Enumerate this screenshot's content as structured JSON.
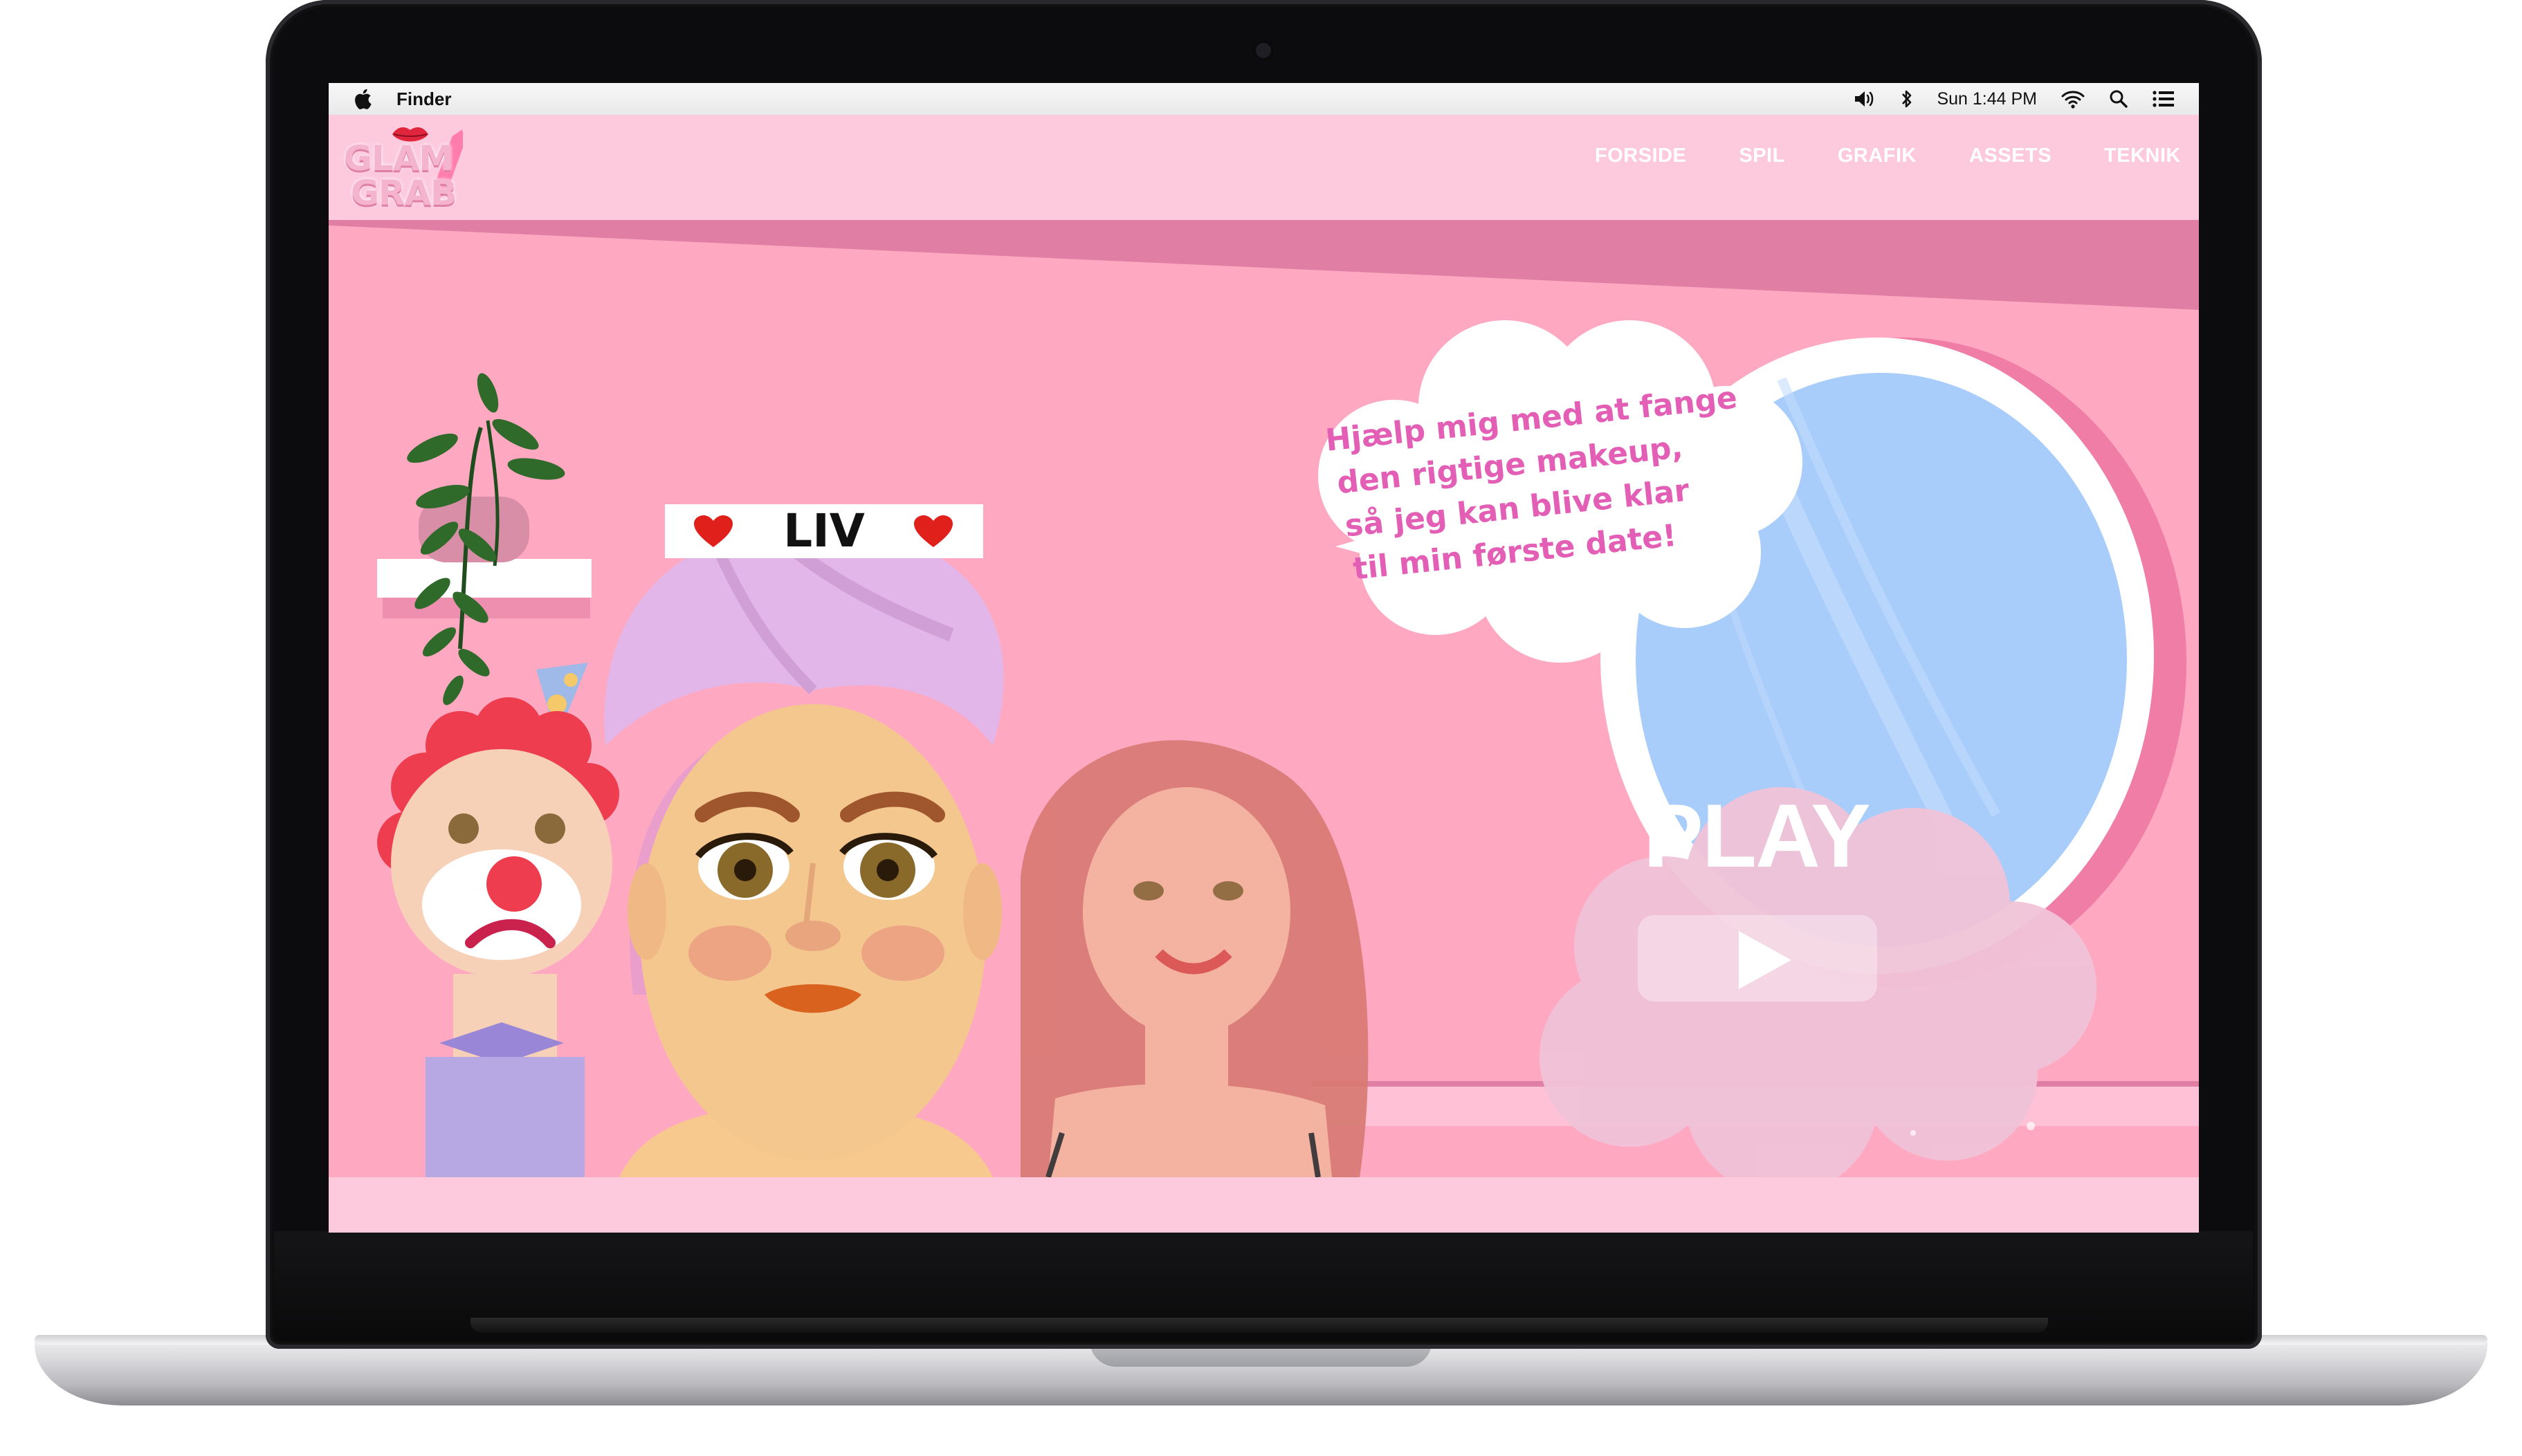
{
  "menubar": {
    "app_name": "Finder",
    "clock": "Sun 1:44 PM",
    "icons": [
      "apple-icon",
      "volume-icon",
      "bluetooth-icon",
      "wifi-icon",
      "search-icon",
      "list-icon"
    ]
  },
  "site": {
    "logo_line1": "GLAM",
    "logo_line2": "GRAB",
    "nav": [
      "FORSIDE",
      "SPIL",
      "GRAFIK",
      "ASSETS",
      "TEKNIK"
    ]
  },
  "hero": {
    "character_name": "LIV",
    "speech_lines": [
      "Hjælp mig med at fange",
      "den rigtige makeup,",
      "så jeg kan blive klar",
      "til min første date!"
    ],
    "play_label": "PLAY"
  },
  "colors": {
    "hero_bg": "#ffa8c2",
    "header_bg": "#fcc9dd",
    "speech_text": "#e35fb5",
    "mirror_glass": "#a9cdfb",
    "heart": "#e0201a"
  }
}
